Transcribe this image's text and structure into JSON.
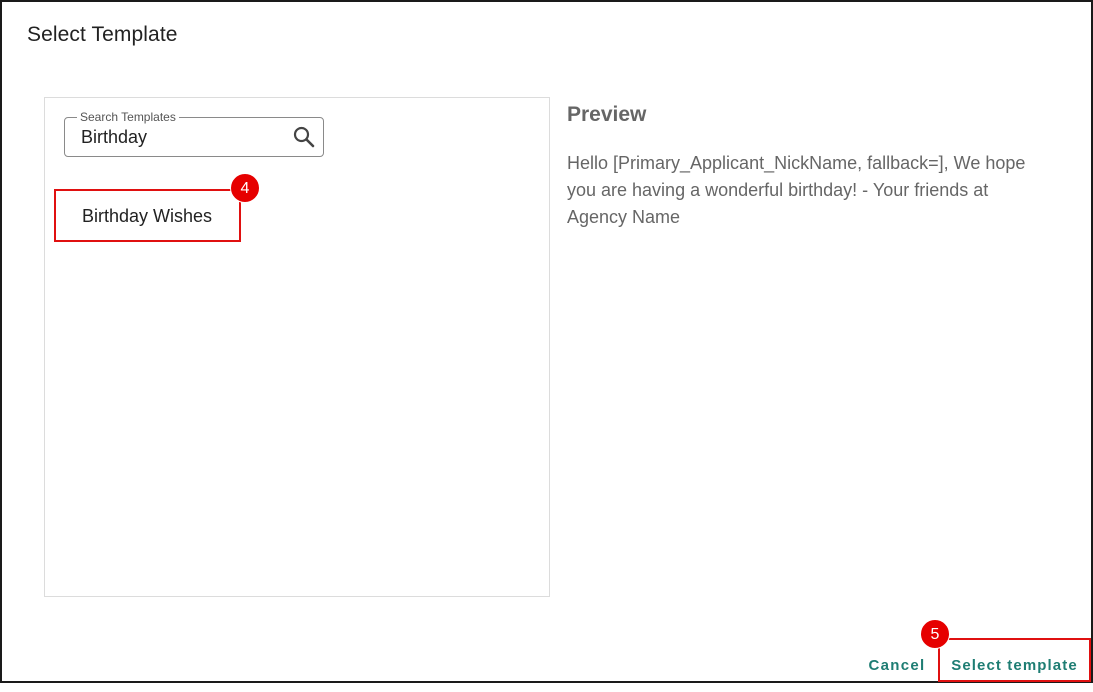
{
  "dialog": {
    "title": "Select Template"
  },
  "search": {
    "label": "Search Templates",
    "value": "Birthday",
    "icon": "search-icon"
  },
  "templates": [
    {
      "label": "Birthday Wishes"
    }
  ],
  "preview": {
    "title": "Preview",
    "body": "Hello [Primary_Applicant_NickName, fallback=], We hope you are having a wonderful birthday! - Your friends at Agency Name"
  },
  "actions": {
    "cancel_label": "Cancel",
    "select_label": "Select template"
  },
  "callouts": {
    "step_4": "4",
    "step_5": "5"
  },
  "colors": {
    "accent": "#1e7d73",
    "highlight": "#e01010",
    "callout": "#e60000"
  }
}
